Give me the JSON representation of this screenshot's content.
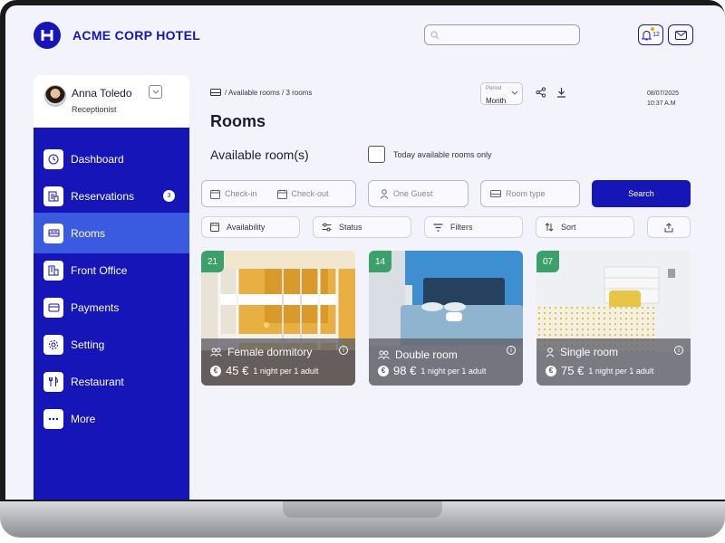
{
  "app": {
    "brand": "ACME CORP HOTEL",
    "accent": "#1515b8",
    "notifications": "12"
  },
  "search": {
    "placeholder": ""
  },
  "user": {
    "name": "Anna Toledo",
    "role": "Receptionist"
  },
  "sidebar": {
    "items": [
      {
        "label": "Dashboard",
        "icon": "clock-icon"
      },
      {
        "label": "Reservations",
        "icon": "calendar-list-icon",
        "badge": "3"
      },
      {
        "label": "Rooms",
        "icon": "bed-icon",
        "active": true
      },
      {
        "label": "Front Office",
        "icon": "building-icon"
      },
      {
        "label": "Payments",
        "icon": "card-icon"
      },
      {
        "label": "Setting",
        "icon": "gear-icon"
      },
      {
        "label": "Restaurant",
        "icon": "cutlery-icon"
      },
      {
        "label": "More",
        "icon": "more-icon"
      }
    ]
  },
  "breadcrumb": "/ Available rooms / 3 rooms",
  "period": {
    "label": "Period",
    "value": "Month"
  },
  "datetime": {
    "date": "08/07/2025",
    "time": "10:37 A.M"
  },
  "main": {
    "title": "Rooms",
    "available_title": "Available room(s)",
    "today_only_label": "Today available rooms only"
  },
  "filters": {
    "checkin": "Check-in",
    "checkout": "Check-out",
    "guests": "One Guest",
    "room_type": "Room type",
    "search_button": "Search",
    "availability": "Availability",
    "status": "Status",
    "filters": "Filters",
    "sort": "Sort"
  },
  "rooms": [
    {
      "number": "21",
      "name": "Female dormitory",
      "price": "45 €",
      "per": "1 night per 1 adult",
      "guest_icon": "group-icon"
    },
    {
      "number": "14",
      "name": "Double room",
      "price": "98 €",
      "per": "1 night per 1 adult",
      "guest_icon": "couple-icon"
    },
    {
      "number": "07",
      "name": "Single room",
      "price": "75 €",
      "per": "1 night per 1 adult",
      "guest_icon": "person-icon"
    }
  ]
}
